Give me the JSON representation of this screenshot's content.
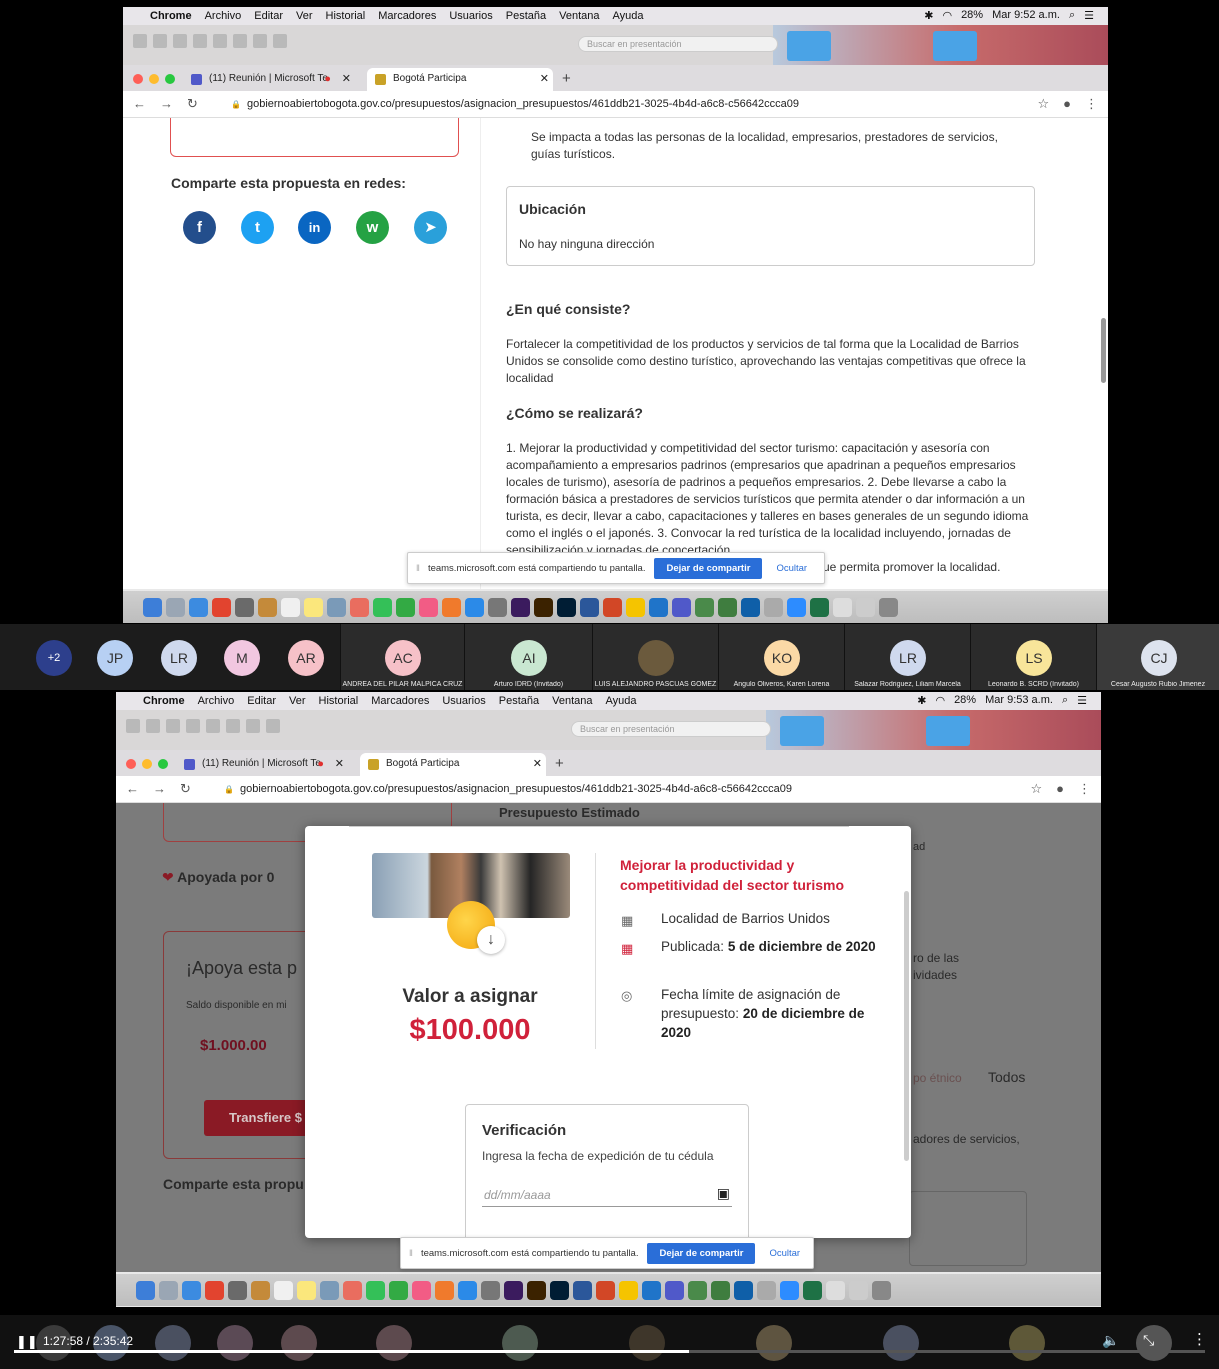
{
  "menubar": {
    "app": "Chrome",
    "items": [
      "Archivo",
      "Editar",
      "Ver",
      "Historial",
      "Marcadores",
      "Usuarios",
      "Pestaña",
      "Ventana",
      "Ayuda"
    ],
    "battery": "28%",
    "time1": "Mar 9:52 a.m.",
    "time2": "Mar 9:53 a.m."
  },
  "finder": {
    "search_placeholder": "Buscar en presentación"
  },
  "browser": {
    "tab1": "(11) Reunión | Microsoft Te",
    "tab2": "Bogotá Participa",
    "url": "gobiernoabiertobogota.gov.co/presupuestos/asignacion_presupuestos/461ddb21-3025-4b4d-a6c8-c56642ccca09"
  },
  "page1": {
    "share_title": "Comparte esta propuesta en redes:",
    "impact_text_1": "Se impacta a todas las personas de la localidad, empresarios, prestadores de servicios,",
    "impact_text_2": "guías turísticos.",
    "ubicacion_title": "Ubicación",
    "ubicacion_value": "No hay ninguna dirección",
    "consiste_title": "¿En qué consiste?",
    "consiste_text": "Fortalecer la competitividad de los productos y servicios de tal forma que la Localidad de Barrios Unidos se consolide como destino turístico, aprovechando las ventajas competitivas que ofrece la localidad",
    "como_title": "¿Cómo se realizará?",
    "como_text": "1. Mejorar la productividad y competitividad del sector turismo: capacitación y asesoría con acompañamiento a empresarios padrinos (empresarios que apadrinan a pequeños empresarios locales de turismo), asesoría de padrinos a pequeños empresarios. 2. Debe llevarse a cabo la formación básica a prestadores de servicios turísticos que permita atender o dar información a un turista, es decir, llevar a cabo, capacitaciones y talleres en bases generales de un segundo idioma como el inglés o el japonés. 3. Convocar la red turística de la localidad incluyendo, jornadas de sensibilización y jornadas de concertación.",
    "como_tail": "ue permita promover la localidad."
  },
  "sharebar": {
    "text": "teams.microsoft.com está compartiendo tu pantalla.",
    "stop": "Dejar de compartir",
    "hide": "Ocultar"
  },
  "participants1": {
    "more": "+2",
    "small": [
      {
        "i": "JP",
        "c": "#b7d0f3"
      },
      {
        "i": "LR",
        "c": "#cfd9ee"
      },
      {
        "i": "M",
        "c": "#f1c7e0"
      },
      {
        "i": "AR",
        "c": "#f6c1c8"
      }
    ],
    "tiles": [
      {
        "i": "AC",
        "c": "#f6c1c8",
        "name": "ANDREA DEL PILAR MALPICA CRUZ"
      },
      {
        "i": "AI",
        "c": "#c9e7d1",
        "name": "Arturo IDRD (Invitado)"
      },
      {
        "i": "",
        "c": "#6b5a3d",
        "name": "LUIS ALEJANDRO PASCUAS GOMEZ"
      },
      {
        "i": "KO",
        "c": "#fbd9a6",
        "name": "Angulo Oliveros, Karen Lorena"
      },
      {
        "i": "LR",
        "c": "#cfd9ee",
        "name": "Salazar Rodriguez, Liliam Marcela"
      },
      {
        "i": "LS",
        "c": "#f8e59a",
        "name": "Leonardo B. SCRD (Invitado)"
      },
      {
        "i": "CJ",
        "c": "#dde3ee",
        "name": "Cesar Augusto Rubio Jimenez"
      }
    ]
  },
  "page2": {
    "bg_presupuesto": "Presupuesto Estimado",
    "bg_apoyada": "Apoyada por 0",
    "bg_apoya": "¡Apoya esta p",
    "bg_saldo": "Saldo disponible en mi",
    "bg_saldo_value": "$1.000.00",
    "bg_transfiere": "Transfiere $",
    "bg_comparte": "Comparte esta propu",
    "bg_ad": "ad",
    "bg_rode": "ro de las",
    "bg_vidades": "ividades",
    "bg_todos": "Todos",
    "bg_etnico": "po étnico",
    "bg_dores": "adores de servicios,",
    "modal_title": "Mejorar la productividad y competitividad del sector turismo",
    "localidad": "Localidad de Barrios Unidos",
    "publicada_label": "Publicada:",
    "publicada_value": "5 de diciembre de 2020",
    "limite_label": "Fecha límite de asignación de presupuesto:",
    "limite_value": "20 de diciembre de 2020",
    "valor_label": "Valor a asignar",
    "valor_amount": "$100.000",
    "verif_title": "Verificación",
    "verif_text": "Ingresa la fecha de expedición de tu cédula",
    "date_placeholder": "dd/mm/aaaa"
  },
  "player": {
    "time": "1:27:58 / 2:35:42",
    "progress": 0.567
  },
  "colors": {
    "accent_red": "#d0213a",
    "teams_blue": "#2a6ed8",
    "facebook": "#234e8c",
    "twitter": "#1da1f2",
    "linkedin": "#0a66c2",
    "whatsapp": "#25a244",
    "telegram": "#2aa0da"
  }
}
